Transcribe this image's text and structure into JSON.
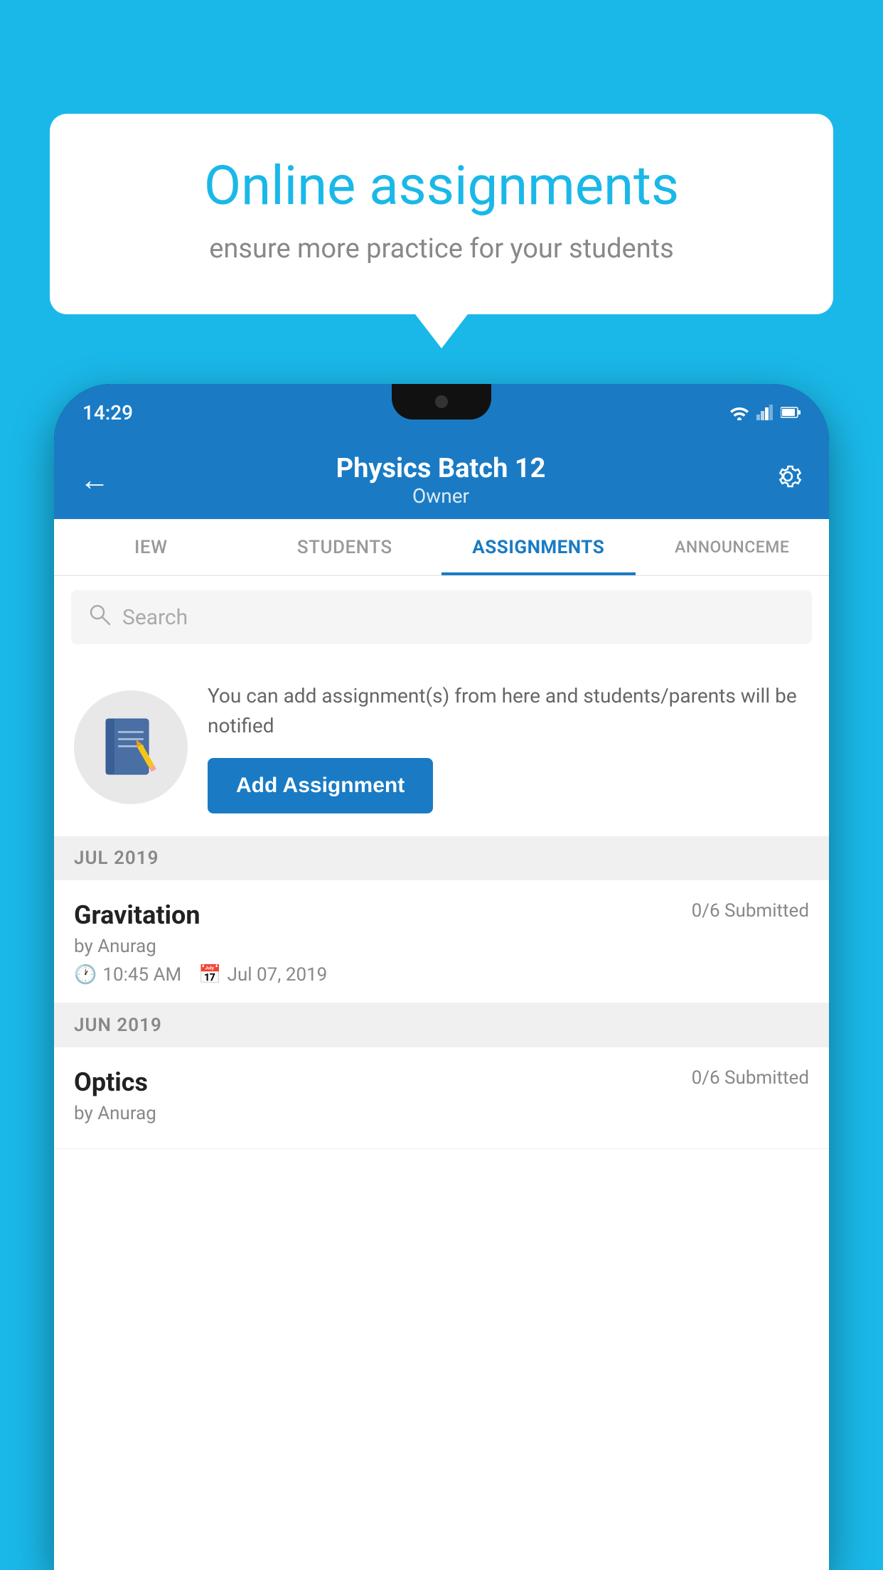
{
  "background_color": "#1ab8e8",
  "speech_bubble": {
    "title": "Online assignments",
    "subtitle": "ensure more practice for your students"
  },
  "phone": {
    "status_bar": {
      "time": "14:29"
    },
    "header": {
      "title": "Physics Batch 12",
      "subtitle": "Owner"
    },
    "tabs": [
      {
        "label": "IEW",
        "active": false
      },
      {
        "label": "STUDENTS",
        "active": false
      },
      {
        "label": "ASSIGNMENTS",
        "active": true
      },
      {
        "label": "ANNOUNCEME",
        "active": false
      }
    ],
    "search": {
      "placeholder": "Search"
    },
    "add_assignment_section": {
      "description": "You can add assignment(s) from here and students/parents will be notified",
      "button_label": "Add Assignment"
    },
    "sections": [
      {
        "month_label": "JUL 2019",
        "assignments": [
          {
            "name": "Gravitation",
            "submitted": "0/6 Submitted",
            "by": "by Anurag",
            "time": "10:45 AM",
            "date": "Jul 07, 2019"
          }
        ]
      },
      {
        "month_label": "JUN 2019",
        "assignments": [
          {
            "name": "Optics",
            "submitted": "0/6 Submitted",
            "by": "by Anurag",
            "time": "",
            "date": ""
          }
        ]
      }
    ]
  }
}
